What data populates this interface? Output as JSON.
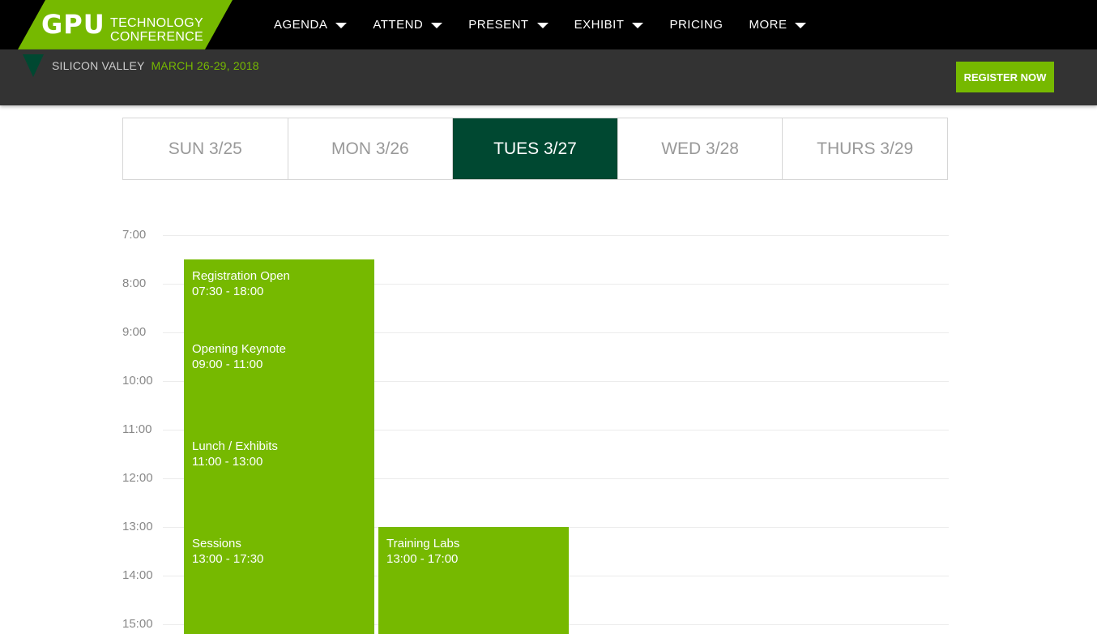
{
  "logo": {
    "gpu": "GPU",
    "line1": "TECHNOLOGY",
    "line2": "CONFERENCE"
  },
  "nav": [
    {
      "label": "AGENDA",
      "dropdown": true
    },
    {
      "label": "ATTEND",
      "dropdown": true
    },
    {
      "label": "PRESENT",
      "dropdown": true
    },
    {
      "label": "EXHIBIT",
      "dropdown": true
    },
    {
      "label": "PRICING",
      "dropdown": false
    },
    {
      "label": "MORE",
      "dropdown": true
    }
  ],
  "venue": {
    "city": "SILICON VALLEY",
    "dates": "MARCH 26-29, 2018"
  },
  "register_label": "REGISTER NOW",
  "colors": {
    "brand_green": "#76b900",
    "active_tab": "#004831",
    "header_black": "#000000",
    "subheader_gray": "#333333"
  },
  "day_tabs": [
    {
      "label": "SUN 3/25",
      "active": false
    },
    {
      "label": "MON 3/26",
      "active": false
    },
    {
      "label": "TUES 3/27",
      "active": true
    },
    {
      "label": "WED 3/28",
      "active": false
    },
    {
      "label": "THURS 3/29",
      "active": false
    }
  ],
  "schedule": {
    "hours": [
      "7:00",
      "8:00",
      "9:00",
      "10:00",
      "11:00",
      "12:00",
      "13:00",
      "14:00",
      "15:00"
    ],
    "events": [
      {
        "title": "Registration Open",
        "time": "07:30 - 18:00",
        "start": 7.5,
        "end": 18.0,
        "column": 0
      },
      {
        "title": "Opening Keynote",
        "time": "09:00 - 11:00",
        "start": 9.0,
        "end": 11.0,
        "column": 0
      },
      {
        "title": "Lunch / Exhibits",
        "time": "11:00 - 13:00",
        "start": 11.0,
        "end": 13.0,
        "column": 0
      },
      {
        "title": "Sessions",
        "time": "13:00 - 17:30",
        "start": 13.0,
        "end": 17.5,
        "column": 0
      },
      {
        "title": "Training Labs",
        "time": "13:00 - 17:00",
        "start": 13.0,
        "end": 17.0,
        "column": 1
      }
    ]
  }
}
